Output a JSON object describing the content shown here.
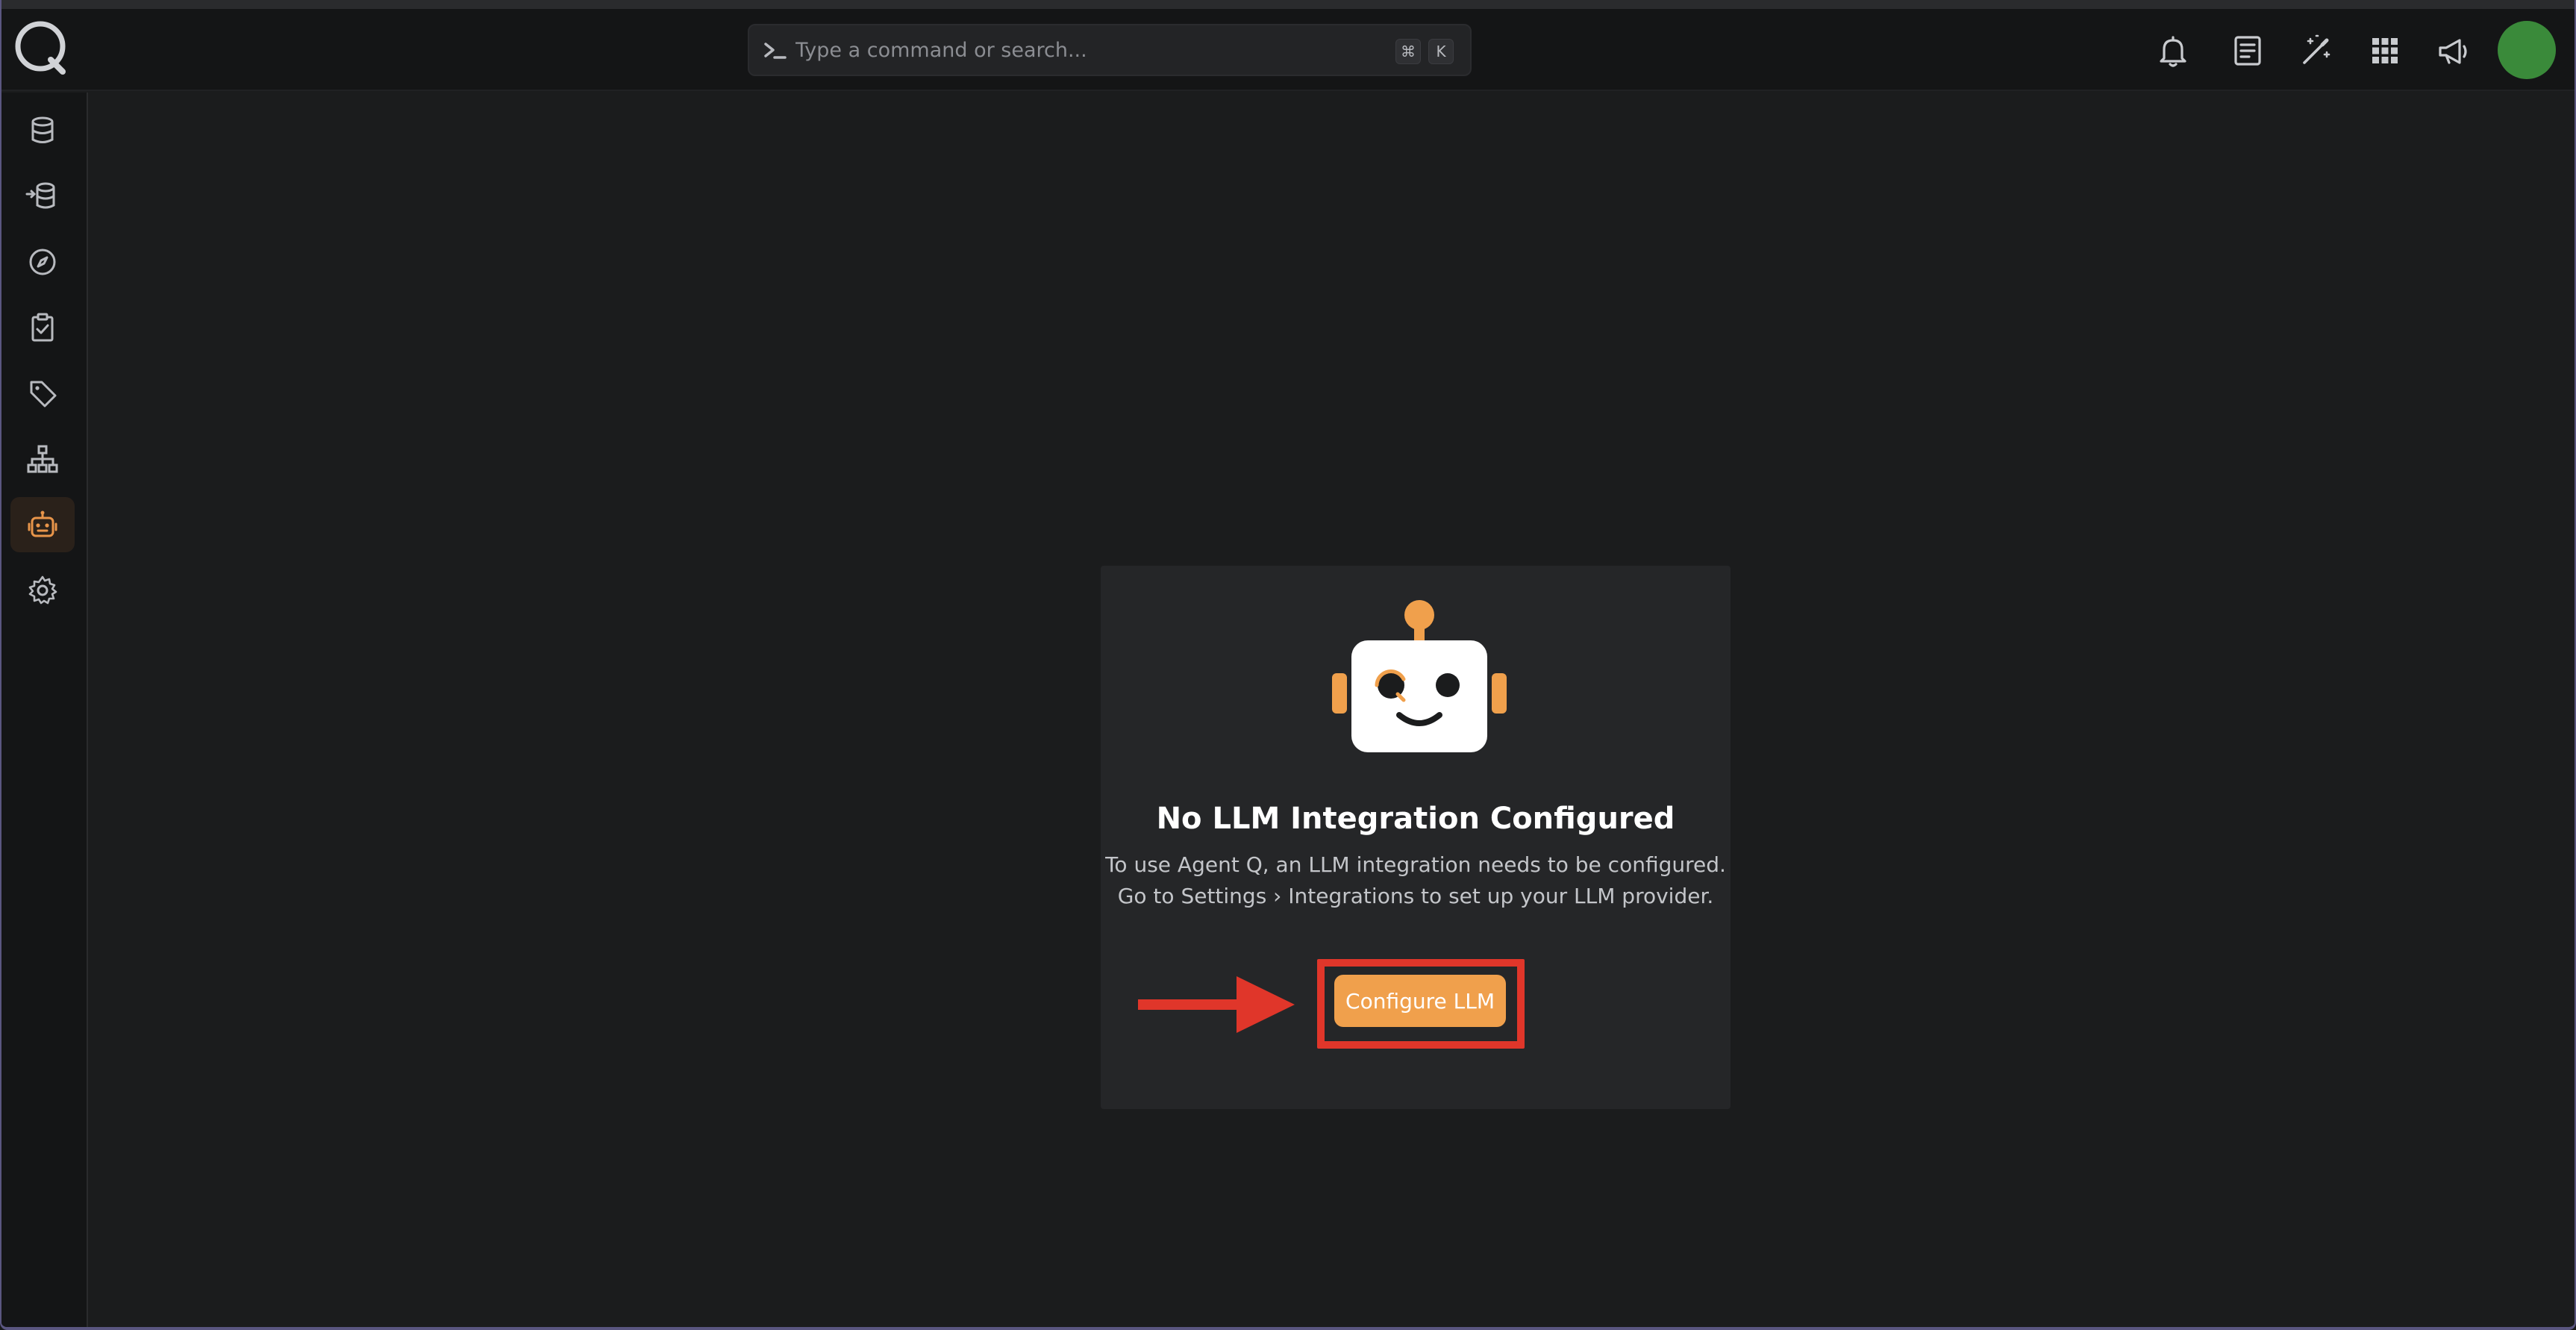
{
  "search": {
    "placeholder": "Type a command or search...",
    "shortcut_cmd": "⌘",
    "shortcut_key": "K"
  },
  "topbar": {
    "icons": [
      "bell-icon",
      "notes-icon",
      "magic-wand-icon",
      "apps-grid-icon",
      "megaphone-icon"
    ]
  },
  "sidebar": {
    "items": [
      {
        "name": "database-icon"
      },
      {
        "name": "data-ingest-icon"
      },
      {
        "name": "compass-icon"
      },
      {
        "name": "clipboard-check-icon"
      },
      {
        "name": "tag-icon"
      },
      {
        "name": "hierarchy-icon"
      },
      {
        "name": "robot-icon",
        "active": true
      },
      {
        "name": "gear-icon"
      }
    ]
  },
  "empty_state": {
    "title": "No LLM Integration Configured",
    "line1": "To use Agent Q, an LLM integration needs to be configured.",
    "line2": "Go to Settings › Integrations to set up your LLM provider.",
    "button_label": "Configure LLM"
  },
  "colors": {
    "accent": "#f0a04c",
    "annotation": "#e0362a",
    "avatar": "#3a8a3a"
  }
}
